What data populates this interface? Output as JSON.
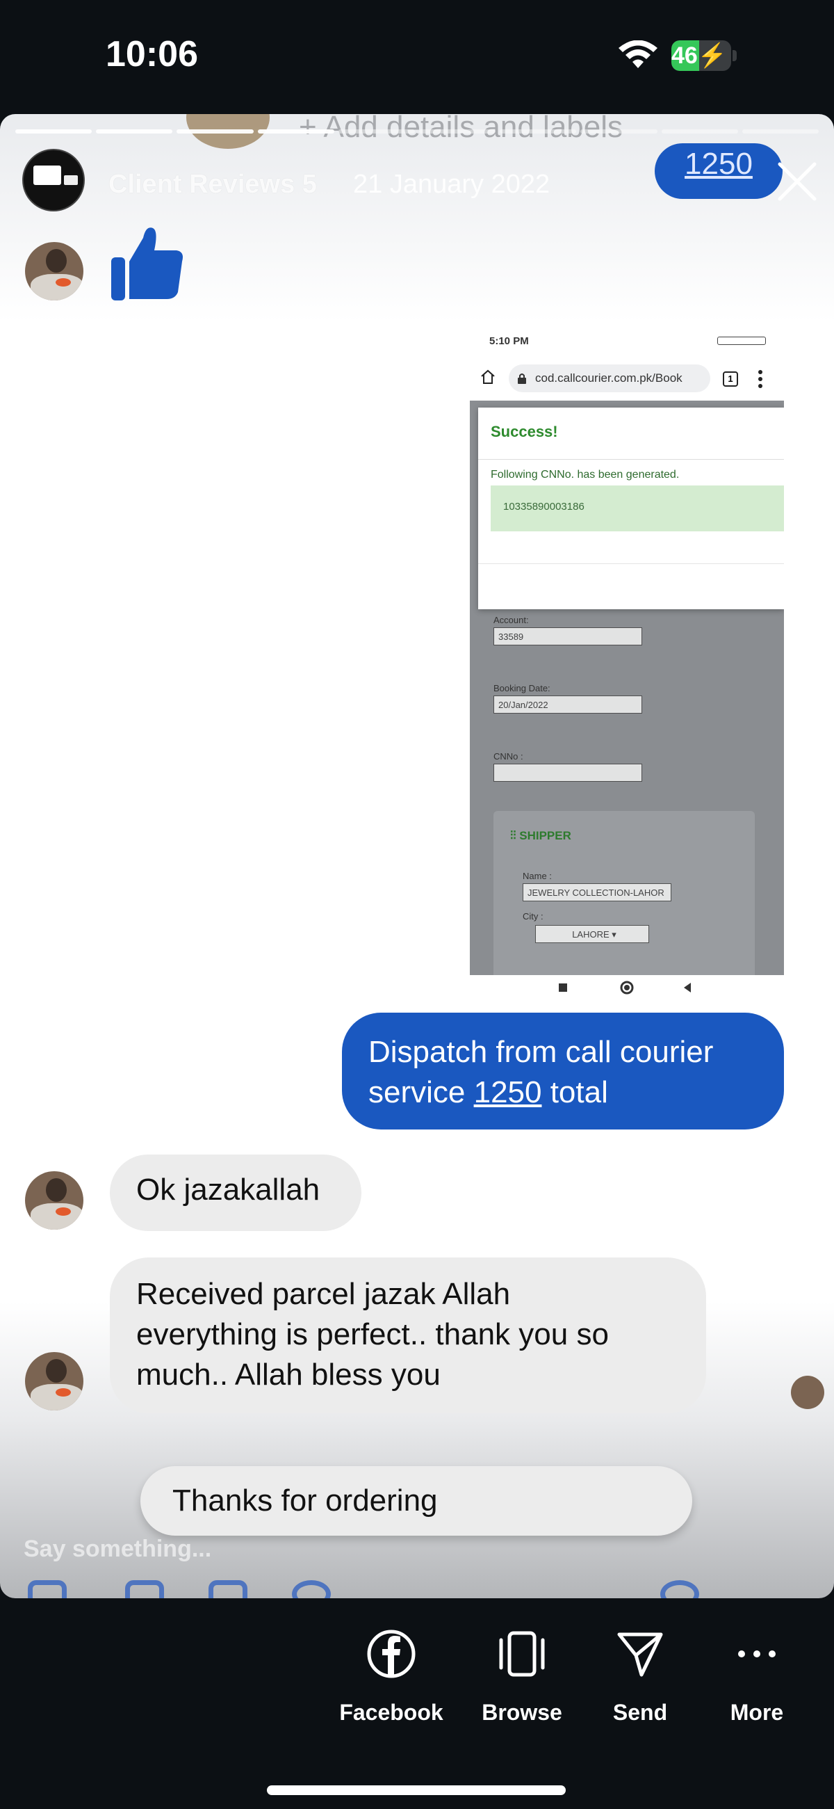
{
  "status_bar": {
    "time": "10:06",
    "battery": "46",
    "battery_level": 0.46
  },
  "story": {
    "faded_top_text": "+ Add details and labels",
    "client_name": "Client Reviews 5",
    "date": "21 January 2022",
    "top_price": "1250"
  },
  "embedded_screenshot": {
    "time": "5:10 PM",
    "url": "cod.callcourier.com.pk/Book",
    "tab_count": "1",
    "modal_title": "Success!",
    "modal_text": "Following CNNo. has been generated.",
    "cn_number": "10335890003186",
    "account_label": "Account:",
    "account_value": "33589",
    "booking_date_label": "Booking Date:",
    "booking_date_value": "20/Jan/2022",
    "cnno_label": "CNNo :",
    "shipper_title": "SHIPPER",
    "name_label": "Name :",
    "name_value": "JEWELRY COLLECTION-LAHOR",
    "city_label": "City :",
    "city_value": "LAHORE"
  },
  "messages": {
    "dispatch_line1": "Dispatch from call courier",
    "dispatch_prefix": "service ",
    "dispatch_amount": "1250",
    "dispatch_suffix": " total",
    "reply1": "Ok jazakallah",
    "reply2_line1": "Received parcel jazak Allah",
    "reply2_line2": "everything is perfect.. thank you so",
    "reply2_line3": "much.. Allah bless you",
    "quick_reply": "Thanks for ordering",
    "composer_placeholder": "Say something..."
  },
  "bottom_actions": [
    {
      "label": "Facebook",
      "icon": "facebook-icon"
    },
    {
      "label": "Browse",
      "icon": "browse-icon"
    },
    {
      "label": "Send",
      "icon": "send-icon"
    },
    {
      "label": "More",
      "icon": "more-icon"
    }
  ],
  "colors": {
    "accent_blue": "#1a58c0",
    "bubble_gray": "#ececec",
    "success_green": "#2e8b2e",
    "battery_green": "#35c759"
  }
}
